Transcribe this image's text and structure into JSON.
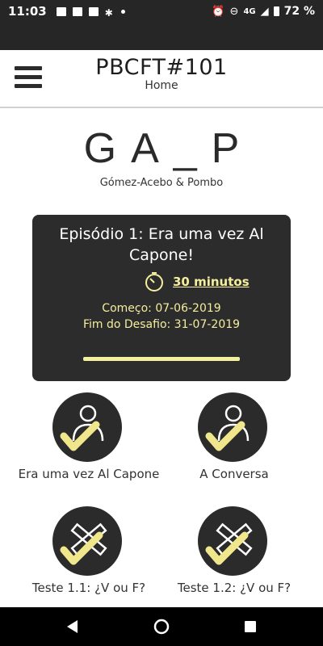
{
  "status_bar": {
    "time": "11:03",
    "network": "4G",
    "battery": "72 %"
  },
  "header": {
    "title": "PBCFT#101",
    "subtitle": "Home"
  },
  "logo": {
    "text": "GA_P",
    "subtitle": "Gómez-Acebo & Pombo"
  },
  "episode": {
    "title": "Episódio 1: Era uma vez Al Capone!",
    "duration": "30 minutos",
    "start": "Começo: 07-06-2019",
    "end": "Fim do Desafio: 31-07-2019",
    "progress": 1.0
  },
  "activities": [
    {
      "label": "Era uma vez Al Capone",
      "icon": "person-check-icon"
    },
    {
      "label": "A Conversa",
      "icon": "person-check-icon"
    },
    {
      "label": "Teste 1.1: ¿V ou F?",
      "icon": "tools-check-icon"
    },
    {
      "label": "Teste 1.2: ¿V ou F?",
      "icon": "tools-check-icon"
    }
  ],
  "colors": {
    "dark": "#2c2c2c",
    "accent": "#f5ee9e",
    "check": "#f0e68c"
  }
}
